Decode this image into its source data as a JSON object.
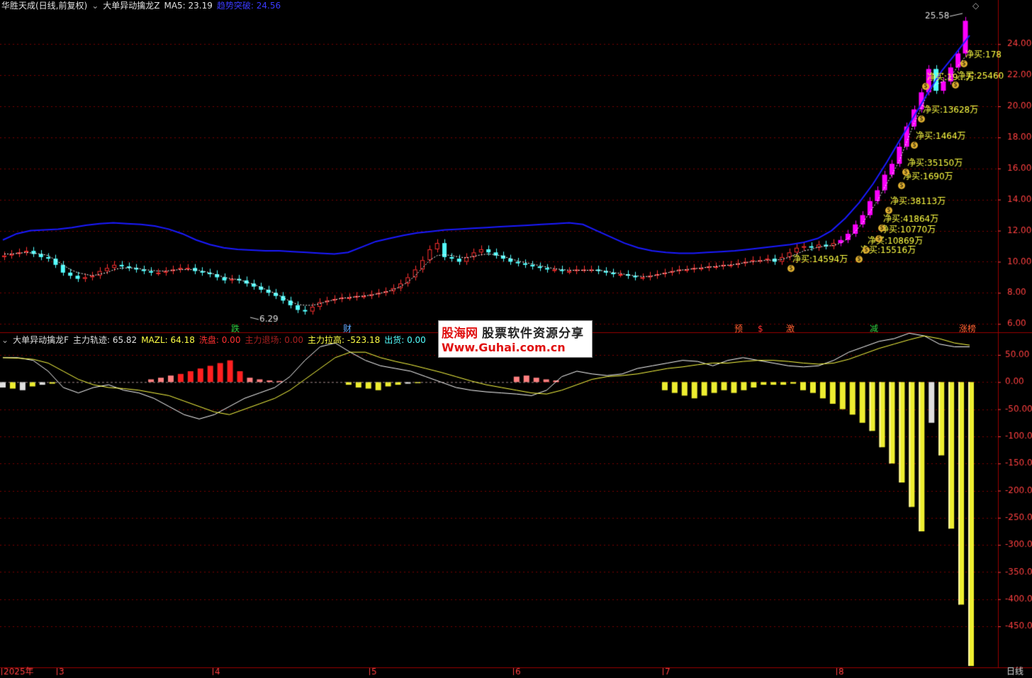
{
  "main_header": {
    "stock": "华胜天成(日线,前复权)",
    "indicator": "大单异动擒龙Z",
    "ma5_label": "MA5: 23.19",
    "breakout_label": "趋势突破: 24.56"
  },
  "sub_header": {
    "indicator": "大单异动擒龙F",
    "track": "主力轨迹: 65.82",
    "mazl": "MAZL: 64.18",
    "wash": "洗盘: 0.00",
    "exit": "主力退场: 0.00",
    "pull": "主力拉高: -523.18",
    "ship": "出货: 0.00"
  },
  "watermark": {
    "brand": "股海网",
    "slogan": "股票软件资源分享",
    "url": "Www.Guhai.com.cn"
  },
  "price_axis": [
    "24.00",
    "22.00",
    "20.00",
    "18.00",
    "16.00",
    "14.00",
    "12.00",
    "10.00",
    "8.00",
    "6.00"
  ],
  "sub_axis": [
    "50.00",
    "0.00",
    "-50.00",
    "-100.0",
    "-150.0",
    "-200.0",
    "-250.0",
    "-300.0",
    "-350.0",
    "-400.0",
    "-450.0"
  ],
  "time_axis": [
    "2025年",
    "3",
    "4",
    "5",
    "6",
    "7",
    "8"
  ],
  "period_label": "日线",
  "high_label": "25.58",
  "low_label": "6.29",
  "event_badges": [
    {
      "text": "跌",
      "color": "#2ecc40"
    },
    {
      "text": "财",
      "color": "#5fa8ff"
    },
    {
      "text": "预",
      "color": "#ff6030"
    },
    {
      "text": "$",
      "color": "#ff3030"
    },
    {
      "text": "激",
      "color": "#ff6030"
    },
    {
      "text": "减",
      "color": "#2ecc40"
    },
    {
      "text": "涨榜",
      "color": "#ff6030"
    }
  ],
  "net_buy_labels": [
    "净买:14594万",
    "净买:15516万",
    "净买:10869万",
    "净买:10770万",
    "净买:41864万",
    "净买:38113万",
    "净买:1690万",
    "净买:35150万",
    "净买:1464万",
    "净买:13628万",
    "净买:19...万",
    "净买:25460",
    "净买:178"
  ],
  "colors": {
    "up": "#ff3030",
    "down": "#54ffff",
    "surge": "#ff00ff",
    "trend": "#1a1aff",
    "grid": "#7a0000",
    "label_yellow": "#ffff44"
  },
  "chart_data": {
    "type": "candlestick",
    "price_range": [
      5.6,
      26.2
    ],
    "closes": [
      10.4,
      10.5,
      10.6,
      10.7,
      10.5,
      10.3,
      10.2,
      9.8,
      9.3,
      9.1,
      8.9,
      9.0,
      9.1,
      9.4,
      9.6,
      9.8,
      9.7,
      9.6,
      9.5,
      9.4,
      9.3,
      9.3,
      9.4,
      9.5,
      9.6,
      9.6,
      9.4,
      9.3,
      9.2,
      9.0,
      8.8,
      8.9,
      8.8,
      8.6,
      8.4,
      8.2,
      8.0,
      7.8,
      7.5,
      7.2,
      6.9,
      6.8,
      7.1,
      7.4,
      7.5,
      7.6,
      7.7,
      7.7,
      7.8,
      7.8,
      7.9,
      8.0,
      8.1,
      8.3,
      8.6,
      9.0,
      9.5,
      10.1,
      10.8,
      11.2,
      10.3,
      10.2,
      10.0,
      10.3,
      10.6,
      10.8,
      10.6,
      10.4,
      10.2,
      10.0,
      9.9,
      9.8,
      9.7,
      9.6,
      9.5,
      9.5,
      9.4,
      9.4,
      9.5,
      9.5,
      9.5,
      9.4,
      9.3,
      9.2,
      9.2,
      9.1,
      9.0,
      9.0,
      9.1,
      9.2,
      9.3,
      9.4,
      9.5,
      9.5,
      9.6,
      9.6,
      9.7,
      9.7,
      9.8,
      9.8,
      9.9,
      10.0,
      10.1,
      10.1,
      10.2,
      10.0,
      10.3,
      10.6,
      10.9,
      11.0,
      10.9,
      11.1,
      11.0,
      11.2,
      11.4,
      11.8,
      12.4,
      13.0,
      13.9,
      14.6,
      15.6,
      16.3,
      17.4,
      18.7,
      19.8,
      20.9,
      22.4,
      21.0,
      21.6,
      22.5,
      23.4,
      25.5
    ],
    "ma5": [
      10.5,
      10.5,
      10.55,
      10.6,
      10.55,
      10.5,
      10.4,
      10.1,
      9.8,
      9.5,
      9.3,
      9.2,
      9.1,
      9.2,
      9.3,
      9.5,
      9.6,
      9.6,
      9.6,
      9.5,
      9.45,
      9.4,
      9.4,
      9.45,
      9.5,
      9.5,
      9.5,
      9.4,
      9.3,
      9.15,
      9.0,
      8.9,
      8.85,
      8.7,
      8.55,
      8.35,
      8.15,
      7.95,
      7.7,
      7.45,
      7.25,
      7.2,
      7.2,
      7.3,
      7.45,
      7.55,
      7.65,
      7.7,
      7.75,
      7.8,
      7.85,
      7.95,
      8.05,
      8.2,
      8.4,
      8.7,
      9.1,
      9.6,
      10.1,
      10.4,
      10.45,
      10.4,
      10.3,
      10.25,
      10.35,
      10.45,
      10.5,
      10.45,
      10.35,
      10.2,
      10.05,
      9.95,
      9.85,
      9.75,
      9.65,
      9.55,
      9.5,
      9.45,
      9.45,
      9.45,
      9.45,
      9.45,
      9.4,
      9.3,
      9.25,
      9.15,
      9.1,
      9.05,
      9.05,
      9.15,
      9.25,
      9.35,
      9.45,
      9.5,
      9.55,
      9.6,
      9.65,
      9.7,
      9.75,
      9.8,
      9.85,
      9.95,
      10.0,
      10.05,
      10.1,
      10.1,
      10.15,
      10.3,
      10.5,
      10.7,
      10.8,
      10.95,
      11.0,
      11.05,
      11.2,
      11.5,
      11.95,
      12.5,
      13.2,
      13.9,
      14.8,
      15.6,
      16.5,
      17.7,
      18.9,
      19.9,
      21.0,
      21.4,
      21.6,
      21.9,
      22.6,
      23.2
    ],
    "trend": [
      11.4,
      11.8,
      12.0,
      12.05,
      12.1,
      12.2,
      12.35,
      12.45,
      12.5,
      12.45,
      12.4,
      12.3,
      12.1,
      11.8,
      11.4,
      11.1,
      10.9,
      10.8,
      10.75,
      10.7,
      10.7,
      10.65,
      10.6,
      10.55,
      10.5,
      10.6,
      10.95,
      11.3,
      11.5,
      11.7,
      11.85,
      11.95,
      12.05,
      12.1,
      12.15,
      12.2,
      12.25,
      12.3,
      12.35,
      12.4,
      12.45,
      12.5,
      12.4,
      12.0,
      11.6,
      11.2,
      10.9,
      10.7,
      10.6,
      10.55,
      10.55,
      10.6,
      10.65,
      10.7,
      10.8,
      10.9,
      11.0,
      11.1,
      11.25,
      11.5,
      12.0,
      12.8,
      13.8,
      15.0,
      16.4,
      17.9,
      19.4,
      20.9,
      22.3,
      23.4,
      24.56
    ],
    "sub_track": [
      45,
      45,
      40,
      20,
      -10,
      -20,
      -10,
      -5,
      -15,
      -20,
      -30,
      -45,
      -60,
      -68,
      -60,
      -45,
      -30,
      -20,
      -10,
      10,
      40,
      65,
      72,
      55,
      40,
      30,
      25,
      20,
      10,
      0,
      -10,
      -15,
      -18,
      -20,
      -22,
      -25,
      -15,
      10,
      20,
      15,
      12,
      15,
      25,
      30,
      35,
      40,
      38,
      30,
      40,
      45,
      40,
      35,
      30,
      28,
      30,
      40,
      55,
      65,
      75,
      80,
      90,
      85,
      70,
      65,
      65
    ],
    "sub_mazl": [
      45,
      44,
      42,
      35,
      20,
      5,
      -5,
      -10,
      -12,
      -15,
      -20,
      -25,
      -35,
      -45,
      -55,
      -60,
      -50,
      -40,
      -30,
      -15,
      5,
      25,
      45,
      55,
      55,
      45,
      38,
      32,
      25,
      18,
      10,
      2,
      -5,
      -10,
      -15,
      -20,
      -22,
      -15,
      -5,
      5,
      10,
      12,
      15,
      20,
      25,
      28,
      32,
      35,
      35,
      38,
      40,
      40,
      38,
      35,
      33,
      35,
      42,
      52,
      62,
      70,
      78,
      85,
      80,
      72,
      68
    ],
    "sub_bars": [
      -10,
      -12,
      -15,
      -8,
      -5,
      -3,
      0,
      0,
      0,
      0,
      0,
      0,
      0,
      0,
      0,
      5,
      8,
      12,
      15,
      20,
      25,
      30,
      35,
      40,
      20,
      8,
      5,
      3,
      2,
      0,
      0,
      0,
      0,
      0,
      0,
      -5,
      -10,
      -12,
      -15,
      -8,
      -5,
      -3,
      -2,
      0,
      0,
      0,
      0,
      0,
      0,
      0,
      0,
      0,
      10,
      12,
      8,
      5,
      3,
      0,
      0,
      0,
      0,
      0,
      0,
      0,
      0,
      0,
      0,
      -15,
      -20,
      -25,
      -30,
      -25,
      -20,
      -15,
      -20,
      -15,
      -10,
      -5,
      -5,
      -5,
      -3,
      -15,
      -20,
      -30,
      -40,
      -50,
      -60,
      -75,
      -90,
      -120,
      -150,
      -185,
      -230,
      -275,
      -75,
      -135,
      -270,
      -410,
      -523
    ]
  }
}
